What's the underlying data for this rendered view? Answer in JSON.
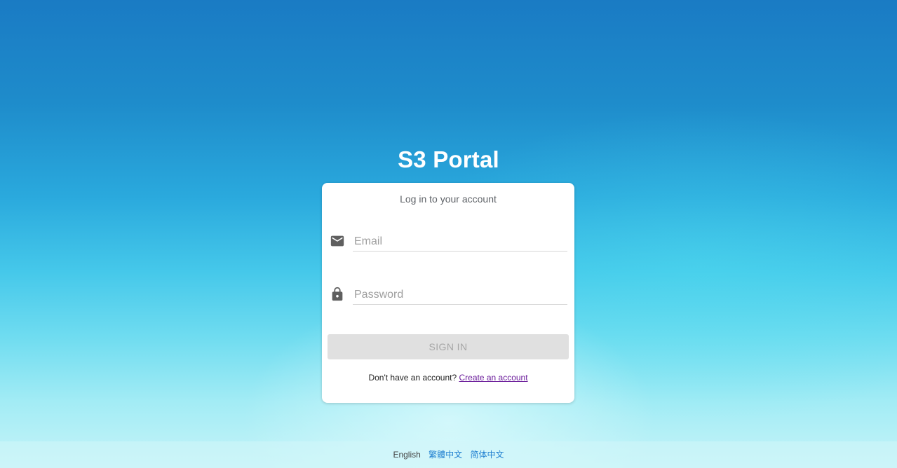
{
  "app": {
    "title": "S3 Portal"
  },
  "login": {
    "heading": "Log in to your account",
    "email": {
      "placeholder": "Email",
      "value": "",
      "icon": "mail-icon"
    },
    "password": {
      "placeholder": "Password",
      "value": "",
      "icon": "lock-icon"
    },
    "signin_label": "SIGN IN",
    "signup_prompt": "Don't have an account?",
    "signup_link": "Create an account"
  },
  "footer": {
    "languages": [
      "English",
      "繁體中文",
      "简体中文"
    ]
  },
  "colors": {
    "link": "#6a1b9a",
    "language_link": "#1f7fd0",
    "button_disabled_bg": "#e0e0e0"
  }
}
